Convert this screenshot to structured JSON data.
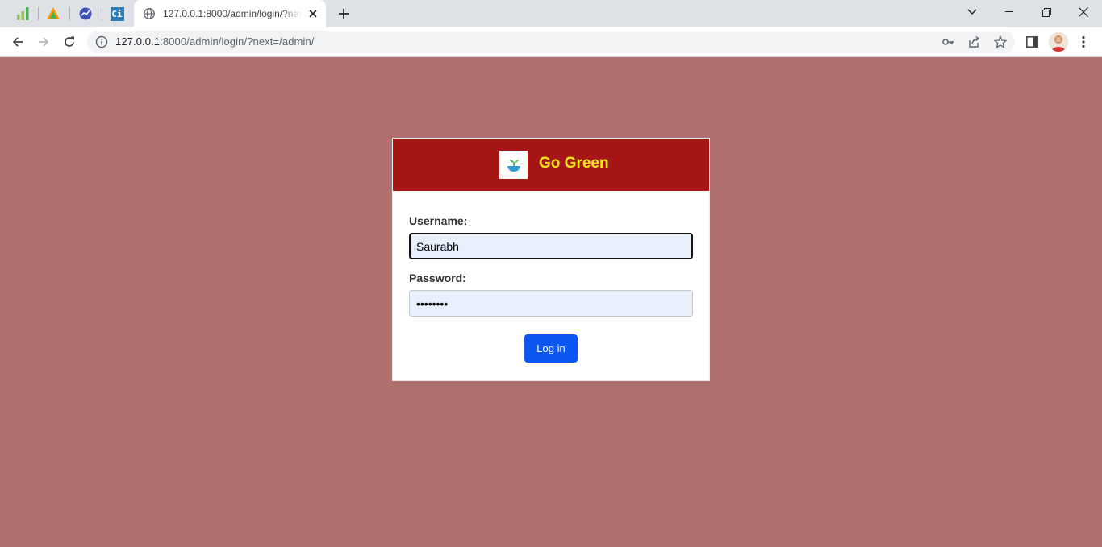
{
  "browser": {
    "pinned_tabs": [
      {
        "icon": "bar-chart-icon"
      },
      {
        "icon": "triangle-logo-icon"
      },
      {
        "icon": "trend-circle-icon"
      },
      {
        "icon": "ci-icon",
        "label": "Ci"
      }
    ],
    "active_tab": {
      "title": "127.0.0.1:8000/admin/login/?next=/admin/",
      "favicon": "globe-icon"
    },
    "address_bar": {
      "host": "127.0.0.1",
      "rest": ":8000/admin/login/?next=/admin/"
    },
    "colors": {
      "tabstrip": "#dee1e6",
      "toolbar": "#ffffff"
    }
  },
  "page": {
    "background": "#b07070",
    "header": {
      "title": "Go Green",
      "background": "#a61616",
      "title_color": "#f5e61b",
      "logo_icon": "plant-bowl-logo-icon"
    },
    "form": {
      "username_label": "Username:",
      "username_value": "Saurabh",
      "password_label": "Password:",
      "password_value": "saurabh1",
      "login_button": "Log in",
      "button_color": "#0b57f0"
    }
  }
}
